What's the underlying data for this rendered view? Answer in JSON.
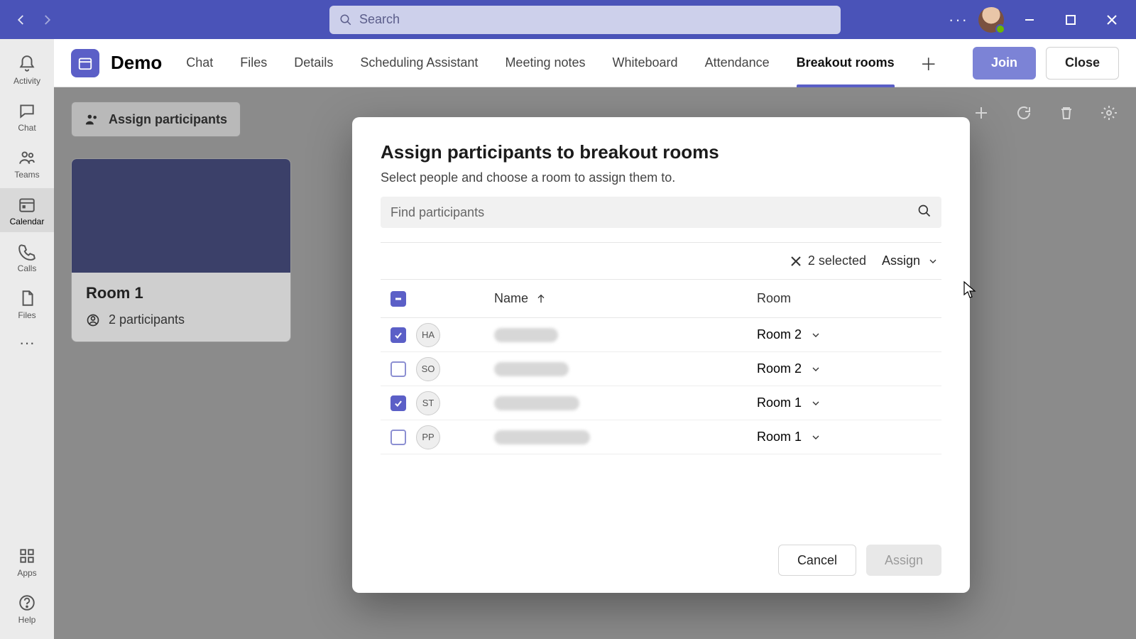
{
  "titlebar": {
    "search_placeholder": "Search"
  },
  "rail": {
    "items": [
      {
        "label": "Activity"
      },
      {
        "label": "Chat"
      },
      {
        "label": "Teams"
      },
      {
        "label": "Calendar"
      },
      {
        "label": "Calls"
      },
      {
        "label": "Files"
      }
    ],
    "apps_label": "Apps",
    "help_label": "Help"
  },
  "header": {
    "meeting_title": "Demo",
    "tabs": [
      "Chat",
      "Files",
      "Details",
      "Scheduling Assistant",
      "Meeting notes",
      "Whiteboard",
      "Attendance",
      "Breakout rooms"
    ],
    "active_tab": 7,
    "join_label": "Join",
    "close_label": "Close"
  },
  "page": {
    "assign_button": "Assign participants",
    "room": {
      "name": "Room 1",
      "participant_count_label": "2 participants"
    }
  },
  "modal": {
    "title": "Assign participants to breakout rooms",
    "subtitle": "Select people and choose a room to assign them to.",
    "search_placeholder": "Find participants",
    "selected_label": "2 selected",
    "assign_dropdown_label": "Assign",
    "columns": {
      "name": "Name",
      "room": "Room"
    },
    "rows": [
      {
        "initials": "HA",
        "room": "Room 2",
        "checked": true
      },
      {
        "initials": "SO",
        "room": "Room 2",
        "checked": false
      },
      {
        "initials": "ST",
        "room": "Room 1",
        "checked": true
      },
      {
        "initials": "PP",
        "room": "Room 1",
        "checked": false
      }
    ],
    "cancel_label": "Cancel",
    "assign_label": "Assign"
  }
}
